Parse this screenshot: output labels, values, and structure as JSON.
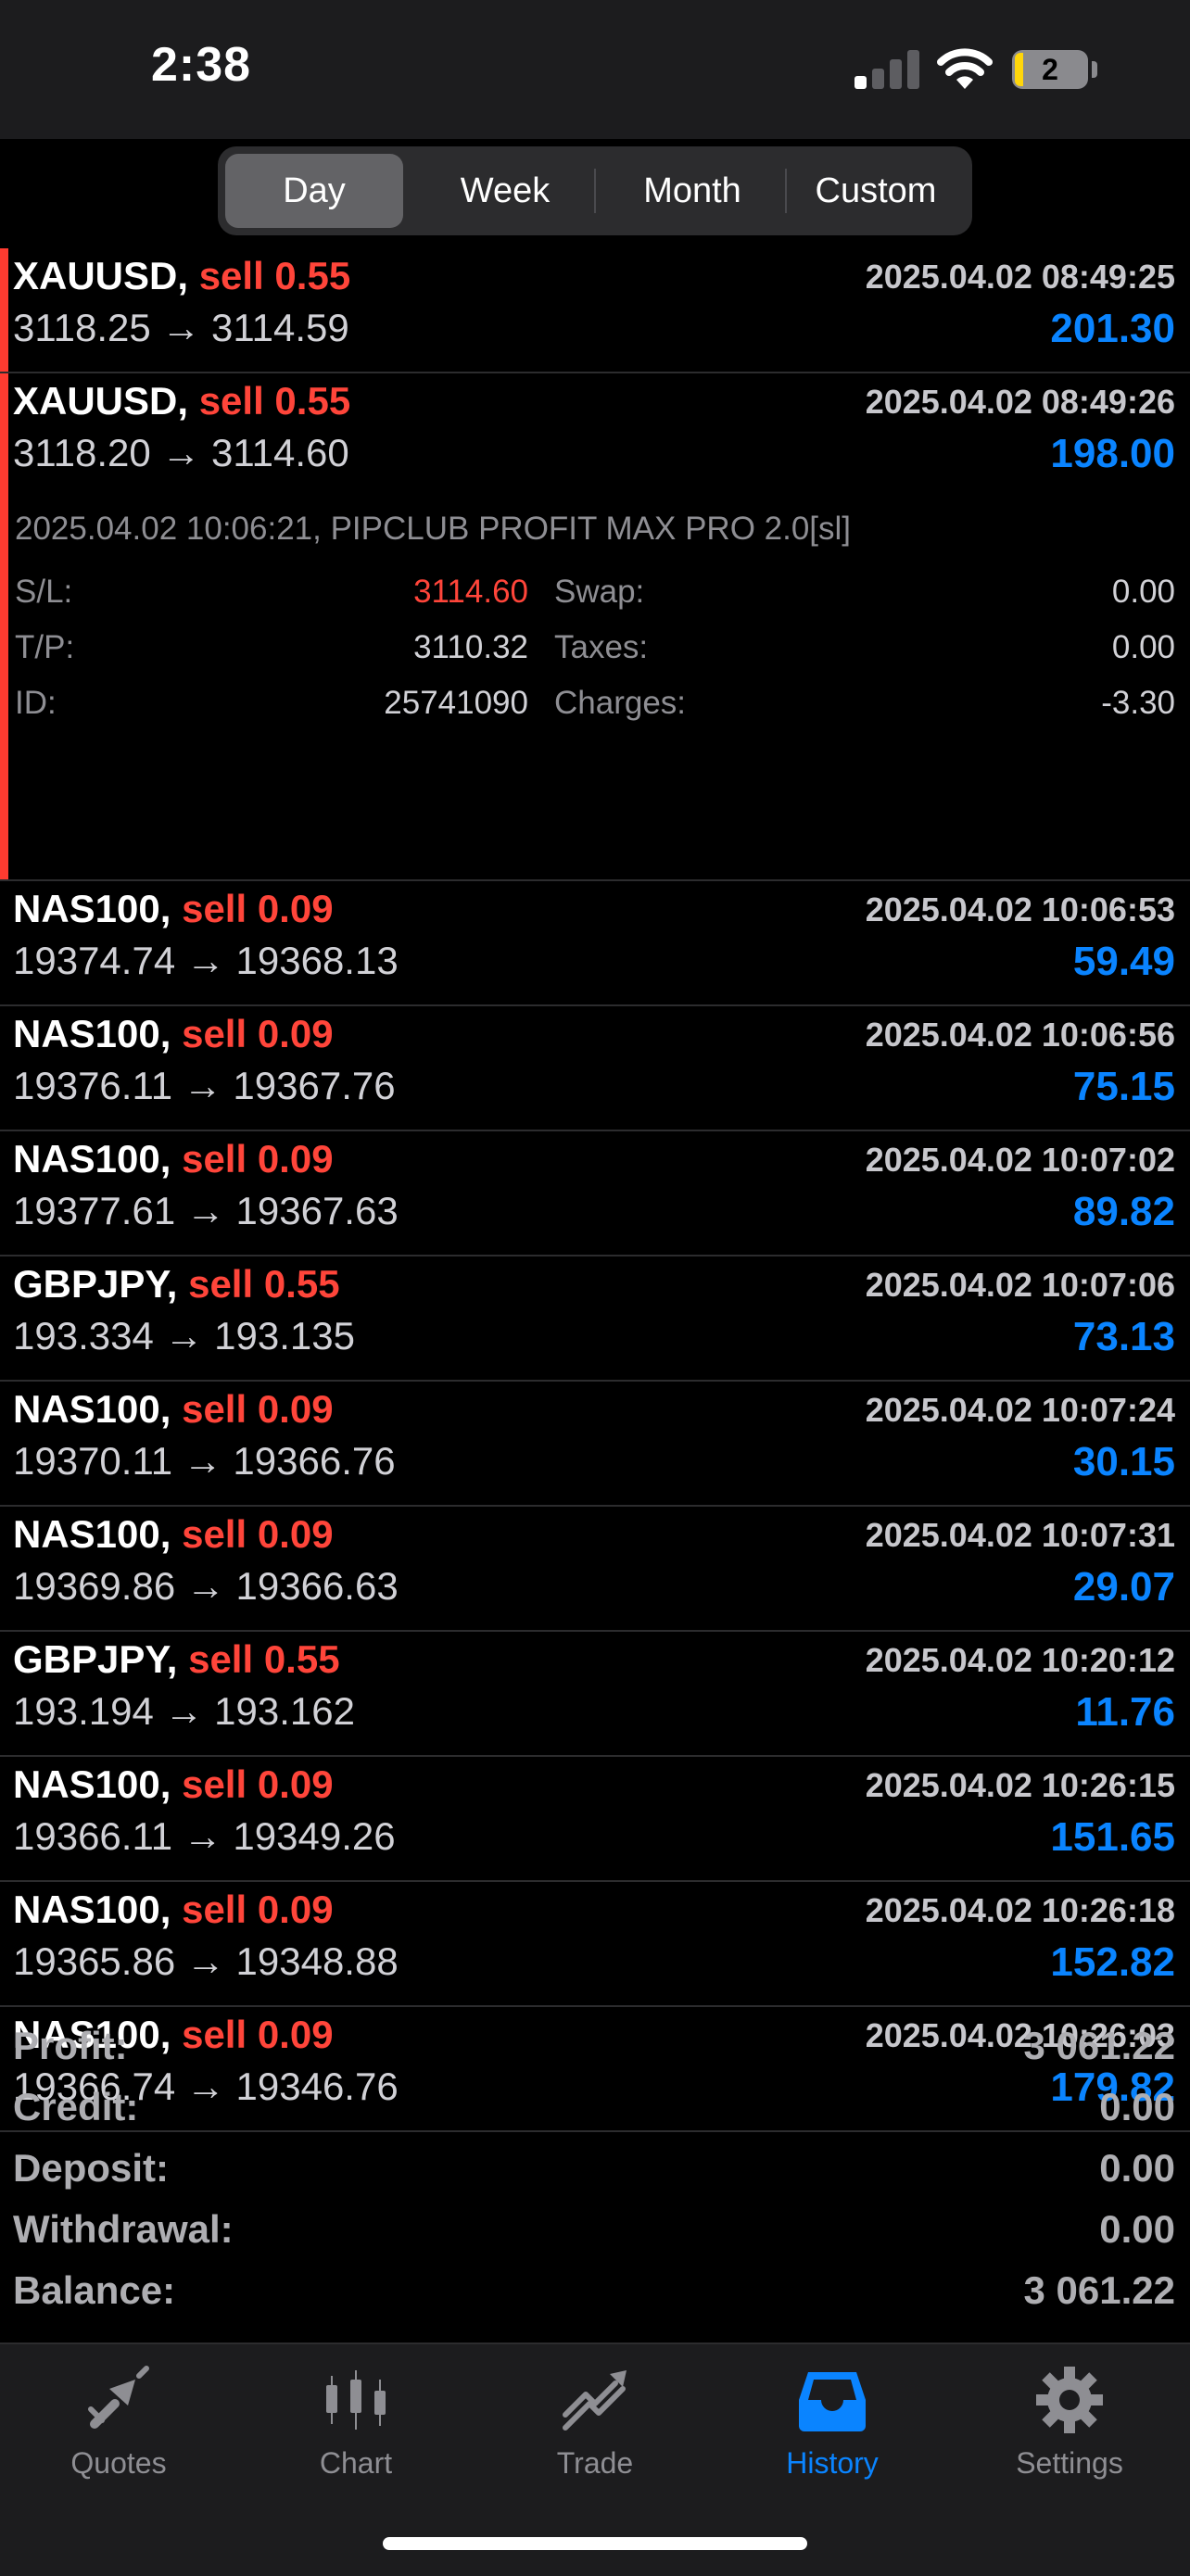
{
  "status_bar": {
    "time": "2:38",
    "battery": "2"
  },
  "periods": [
    {
      "label": "Day",
      "active": true
    },
    {
      "label": "Week",
      "active": false
    },
    {
      "label": "Month",
      "active": false
    },
    {
      "label": "Custom",
      "active": false
    }
  ],
  "deals": [
    {
      "symbol": "XAUUSD,",
      "direction": "sell 0.55",
      "time": "2025.04.02 08:49:25",
      "prices": "3118.25 → 3114.59",
      "profit": "201.30",
      "marked": true
    },
    {
      "symbol": "XAUUSD,",
      "direction": "sell 0.55",
      "time": "2025.04.02 08:49:26",
      "prices": "3118.20 → 3114.60",
      "profit": "198.00",
      "marked": true,
      "details": {
        "comment": "2025.04.02 10:06:21, PIPCLUB PROFIT MAX PRO 2.0[sl]",
        "sl_label": "S/L:",
        "sl": "3114.60",
        "tp_label": "T/P:",
        "tp": "3110.32",
        "id_label": "ID:",
        "id": "25741090",
        "swap_label": "Swap:",
        "swap": "0.00",
        "taxes_label": "Taxes:",
        "taxes": "0.00",
        "charges_label": "Charges:",
        "charges": "-3.30"
      }
    },
    {
      "symbol": "NAS100,",
      "direction": "sell 0.09",
      "time": "2025.04.02 10:06:53",
      "prices": "19374.74 → 19368.13",
      "profit": "59.49"
    },
    {
      "symbol": "NAS100,",
      "direction": "sell 0.09",
      "time": "2025.04.02 10:06:56",
      "prices": "19376.11 → 19367.76",
      "profit": "75.15"
    },
    {
      "symbol": "NAS100,",
      "direction": "sell 0.09",
      "time": "2025.04.02 10:07:02",
      "prices": "19377.61 → 19367.63",
      "profit": "89.82"
    },
    {
      "symbol": "GBPJPY,",
      "direction": "sell 0.55",
      "time": "2025.04.02 10:07:06",
      "prices": "193.334 → 193.135",
      "profit": "73.13"
    },
    {
      "symbol": "NAS100,",
      "direction": "sell 0.09",
      "time": "2025.04.02 10:07:24",
      "prices": "19370.11 → 19366.76",
      "profit": "30.15"
    },
    {
      "symbol": "NAS100,",
      "direction": "sell 0.09",
      "time": "2025.04.02 10:07:31",
      "prices": "19369.86 → 19366.63",
      "profit": "29.07"
    },
    {
      "symbol": "GBPJPY,",
      "direction": "sell 0.55",
      "time": "2025.04.02 10:20:12",
      "prices": "193.194 → 193.162",
      "profit": "11.76"
    },
    {
      "symbol": "NAS100,",
      "direction": "sell 0.09",
      "time": "2025.04.02 10:26:15",
      "prices": "19366.11 → 19349.26",
      "profit": "151.65"
    },
    {
      "symbol": "NAS100,",
      "direction": "sell 0.09",
      "time": "2025.04.02 10:26:18",
      "prices": "19365.86 → 19348.88",
      "profit": "152.82"
    },
    {
      "symbol": "NAS100,",
      "direction": "sell 0.09",
      "time": "2025.04.02 10:26:03",
      "prices": "19366.74 → 19346.76",
      "profit": "179.82"
    }
  ],
  "summary": [
    {
      "label": "Profit:",
      "value": "3 061.22"
    },
    {
      "label": "Credit:",
      "value": "0.00"
    },
    {
      "label": "Deposit:",
      "value": "0.00"
    },
    {
      "label": "Withdrawal:",
      "value": "0.00"
    },
    {
      "label": "Balance:",
      "value": "3 061.22"
    }
  ],
  "tabs": [
    {
      "label": "Quotes",
      "icon": "quotes-icon",
      "active": false
    },
    {
      "label": "Chart",
      "icon": "chart-candles-icon",
      "active": false
    },
    {
      "label": "Trade",
      "icon": "trade-icon",
      "active": false
    },
    {
      "label": "History",
      "icon": "history-inbox-icon",
      "active": true
    },
    {
      "label": "Settings",
      "icon": "gear-icon",
      "active": false
    }
  ],
  "colors": {
    "sell": "#ff453a",
    "profit": "#0a84ff",
    "active_tab": "#0a84ff",
    "marker": "#ff3b30"
  }
}
